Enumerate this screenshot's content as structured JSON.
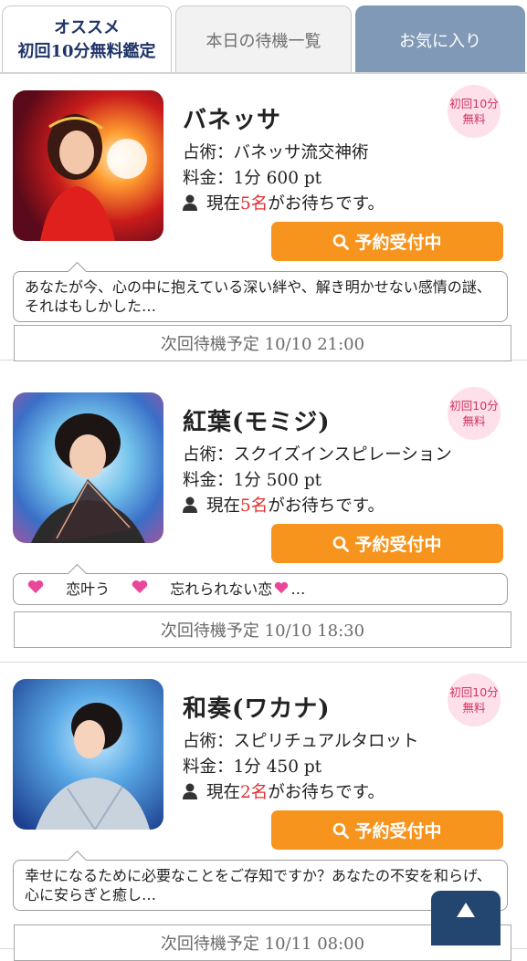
{
  "tabs": {
    "recommend_line1": "オススメ",
    "recommend_line2": "初回10分無料鑑定",
    "today": "本日の待機一覧",
    "favorites": "お気に入り"
  },
  "common": {
    "badge_line1": "初回10分",
    "badge_line2": "無料",
    "reserve_label": "予約受付中",
    "wait_prefix": "現在",
    "wait_suffix": "がお待ちです。"
  },
  "fortune_tellers": [
    {
      "name": "バネッサ",
      "method": "占術：バネッサ流交神術",
      "price": "料金：1分 600 pt",
      "waiting": "5名",
      "message": "あなたが今、心の中に抱えている深い絆や、解き明かせない感情の謎、それはもしかした…",
      "next_schedule": "次回待機予定 10/10 21:00"
    },
    {
      "name": "紅葉(モミジ)",
      "method": "占術：スクイズインスピレーション",
      "price": "料金：1分 500 pt",
      "waiting": "5名",
      "message_part1": "恋叶う",
      "message_part2": "忘れられない恋",
      "message_part3": "…",
      "next_schedule": "次回待機予定 10/10 18:30"
    },
    {
      "name": "和奏(ワカナ)",
      "method": "占術：スピリチュアルタロット",
      "price": "料金：1分 450 pt",
      "waiting": "2名",
      "message": "幸せになるために必要なことをご存知ですか？あなたの不安を和らげ、心に安らぎと癒し…",
      "next_schedule": "次回待機予定 10/11 08:00"
    }
  ],
  "icons": {
    "person": "person-icon",
    "search": "search-icon",
    "heart": "sparkle-heart-icon",
    "page_top": "triangle-up-icon"
  },
  "colors": {
    "accent_orange": "#f7941d",
    "tab_active_text": "#1f3468",
    "tab_fav_bg": "#8099b6",
    "badge_bg": "#fde0ea",
    "badge_text": "#d23262",
    "highlight_red": "#e03030",
    "page_top_bg": "#22466f"
  }
}
